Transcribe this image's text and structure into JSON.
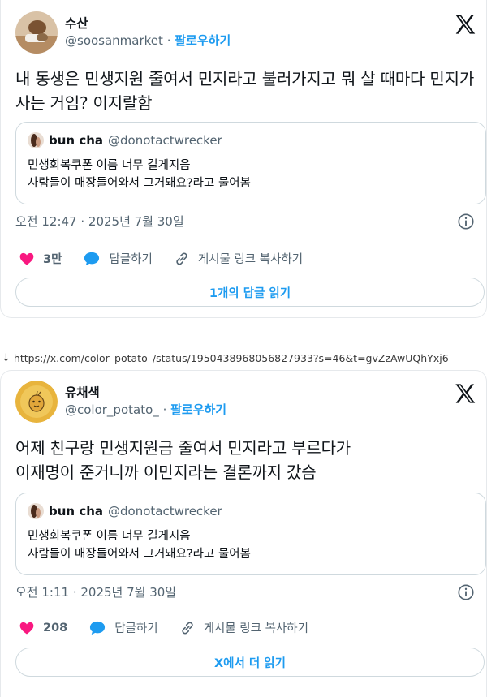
{
  "colors": {
    "accent": "#1d9bf0",
    "like": "#f91880",
    "text": "#0f1419",
    "muted": "#536471",
    "border": "#cfd9de"
  },
  "tweet1": {
    "display_name": "수산",
    "handle": "@soosanmarket",
    "follow_label": "팔로우하기",
    "body": "내 동생은 민생지원 줄여서 민지라고 불러가지고 뭐 살 때마다 민지가 사는 거임? 이지랄함",
    "quote": {
      "name": "bun cha",
      "handle": "@donotactwrecker",
      "line1": "민생회복쿠폰 이름 너무 길게지음",
      "line2": "사람들이 매장들어와서 그거돼요?라고 물어봄"
    },
    "timestamp": "오전 12:47 · 2025년 7월 30일",
    "likes": "3만",
    "reply_label": "답글하기",
    "copy_label": "게시물 링크 복사하기",
    "read_label": "1개의 답글 읽기"
  },
  "url_text": "https://x.com/color_potato_/status/1950438968056827933?s=46&t=gvZzAwUQhYxj6",
  "tweet2": {
    "display_name": "유채색",
    "handle": "@color_potato_",
    "follow_label": "팔로우하기",
    "body_line1": "어제 친구랑 민생지원금 줄여서 민지라고 부르다가",
    "body_line2": "이재명이 준거니까 이민지라는 결론까지 갔슴",
    "quote": {
      "name": "bun cha",
      "handle": "@donotactwrecker",
      "line1": "민생회복쿠폰 이름 너무 길게지음",
      "line2": "사람들이 매장들어와서 그거돼요?라고 물어봄"
    },
    "timestamp": "오전 1:11 · 2025년 7월 30일",
    "likes": "208",
    "reply_label": "답글하기",
    "copy_label": "게시물 링크 복사하기",
    "read_label": "X에서 더 읽기"
  },
  "icons": [
    "x-logo-icon",
    "info-icon",
    "heart-icon",
    "reply-bubble-icon",
    "link-icon",
    "download-arrow-icon"
  ]
}
